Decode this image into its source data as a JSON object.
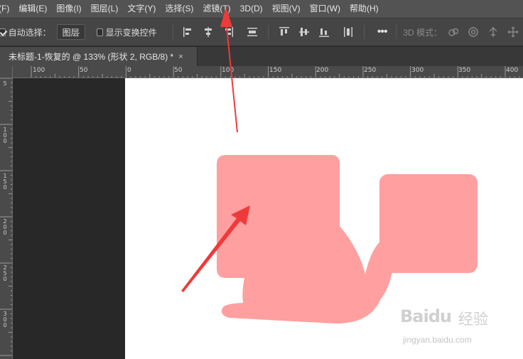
{
  "menubar": {
    "items": [
      "(F)",
      "编辑(E)",
      "图像(I)",
      "图层(L)",
      "文字(Y)",
      "选择(S)",
      "滤镜(T)",
      "3D(D)",
      "视图(V)",
      "窗口(W)",
      "帮助(H)"
    ]
  },
  "options": {
    "auto_select_label": "自动选择：",
    "auto_select_checked": true,
    "layer_select_value": "图层",
    "show_transform_label": "显示变换控件",
    "show_transform_checked": false,
    "more_label": "•••",
    "mode_3d_label": "3D 模式："
  },
  "document": {
    "tab_title": "未标题-1-恢复的 @ 133% (形状 2, RGB/8) *",
    "close_glyph": "×"
  },
  "rulers": {
    "horizontal": [
      "100",
      "50",
      "0",
      "50",
      "100",
      "150",
      "200",
      "250",
      "300",
      "350",
      "400"
    ],
    "vertical": [
      "5",
      "100",
      "150",
      "200",
      "250",
      "300"
    ]
  },
  "shapes": {
    "fill_color": "#ff9f9f",
    "arrow_color": "#f03a3a"
  },
  "watermark": {
    "logo_text": "Baidu",
    "jingyan_text": "经验",
    "url_text": "jingyan.baidu.com"
  }
}
